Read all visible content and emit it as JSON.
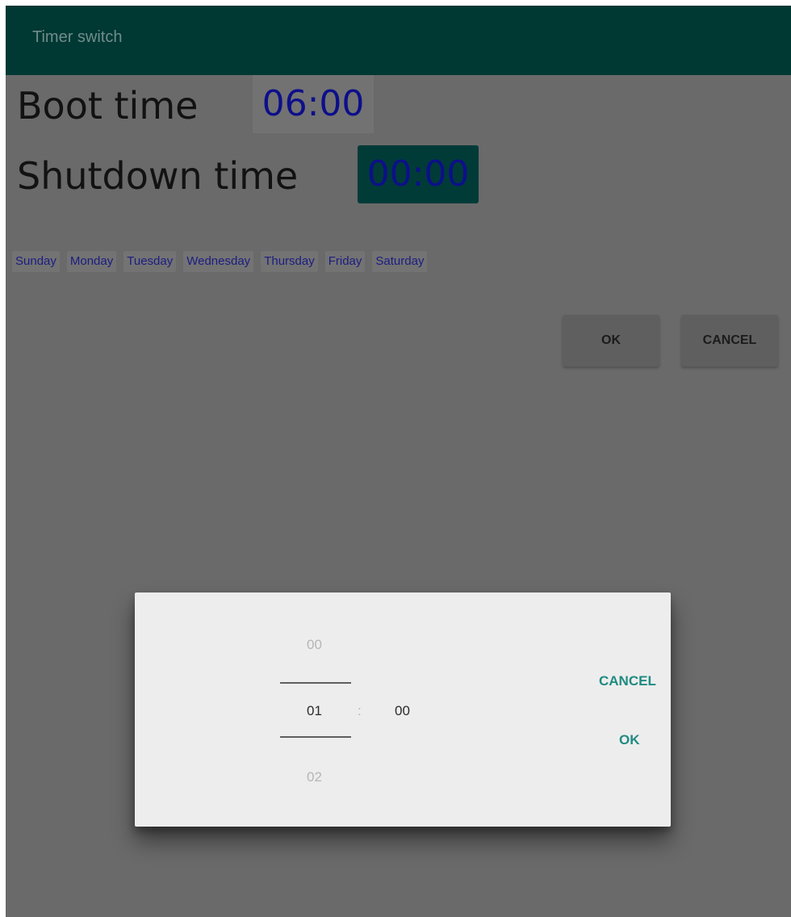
{
  "appbar": {
    "title": "Timer switch",
    "color": "#003833"
  },
  "schedule": {
    "boot_label": "Boot time",
    "boot_value": "06:00",
    "shutdown_label": "Shutdown time",
    "shutdown_value": "00:00"
  },
  "days": [
    "Sunday",
    "Monday",
    "Tuesday",
    "Wednesday",
    "Thursday",
    "Friday",
    "Saturday"
  ],
  "actions": {
    "ok_label": "OK",
    "cancel_label": "CANCEL"
  },
  "time_picker_dialog": {
    "hour_prev": "00",
    "hour_selected": "01",
    "hour_next": "02",
    "separator": ":",
    "minute_selected": "00",
    "cancel_label": "CANCEL",
    "ok_label": "OK",
    "accent_color": "#1f8b82"
  }
}
